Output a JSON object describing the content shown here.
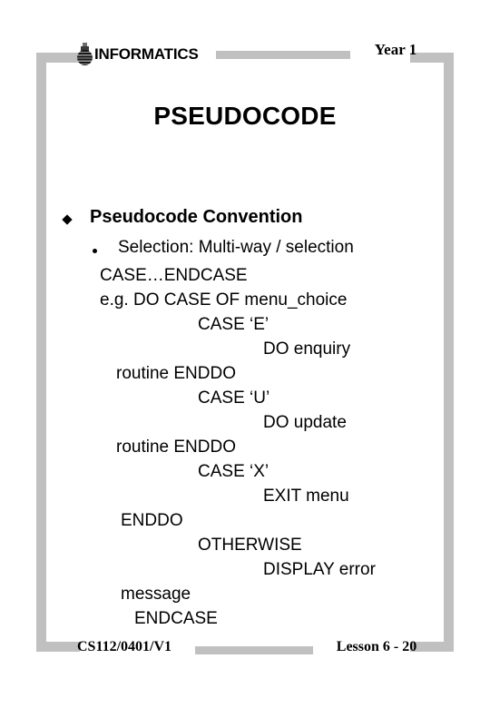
{
  "header": {
    "logo_text": "INFORMATICS",
    "logo_icon": "informatics-figure-icon",
    "year_label": "Year 1"
  },
  "title": "PSEUDOCODE",
  "body": {
    "bullet_level1": {
      "marker": "diamond-bullet",
      "text": "Pseudocode Convention"
    },
    "bullet_level2": {
      "marker": "round-bullet",
      "text": "Selection: Multi-way / selection"
    },
    "code_lines": [
      {
        "text": "CASE…ENDCASE",
        "indent": 110
      },
      {
        "text": "e.g. DO CASE OF menu_choice",
        "indent": 110
      },
      {
        "text": "CASE ‘E’",
        "indent": 218
      },
      {
        "text": "DO enquiry",
        "indent": 290
      },
      {
        "text": "routine ENDDO",
        "indent": 128
      },
      {
        "text": "CASE ‘U’",
        "indent": 218
      },
      {
        "text": "DO update",
        "indent": 290
      },
      {
        "text": "routine ENDDO",
        "indent": 128
      },
      {
        "text": "CASE ‘X’",
        "indent": 218
      },
      {
        "text": "EXIT menu",
        "indent": 290
      },
      {
        "text": "ENDDO",
        "indent": 133
      },
      {
        "text": "OTHERWISE",
        "indent": 218
      },
      {
        "text": "DISPLAY error",
        "indent": 290
      },
      {
        "text": "message",
        "indent": 133
      },
      {
        "text": "ENDCASE",
        "indent": 148
      }
    ]
  },
  "footer": {
    "code": "CS112/0401/V1",
    "lesson": "Lesson 6 - 20"
  },
  "colors": {
    "frame": "#c0c0c0",
    "text": "#000000",
    "background": "#ffffff"
  }
}
